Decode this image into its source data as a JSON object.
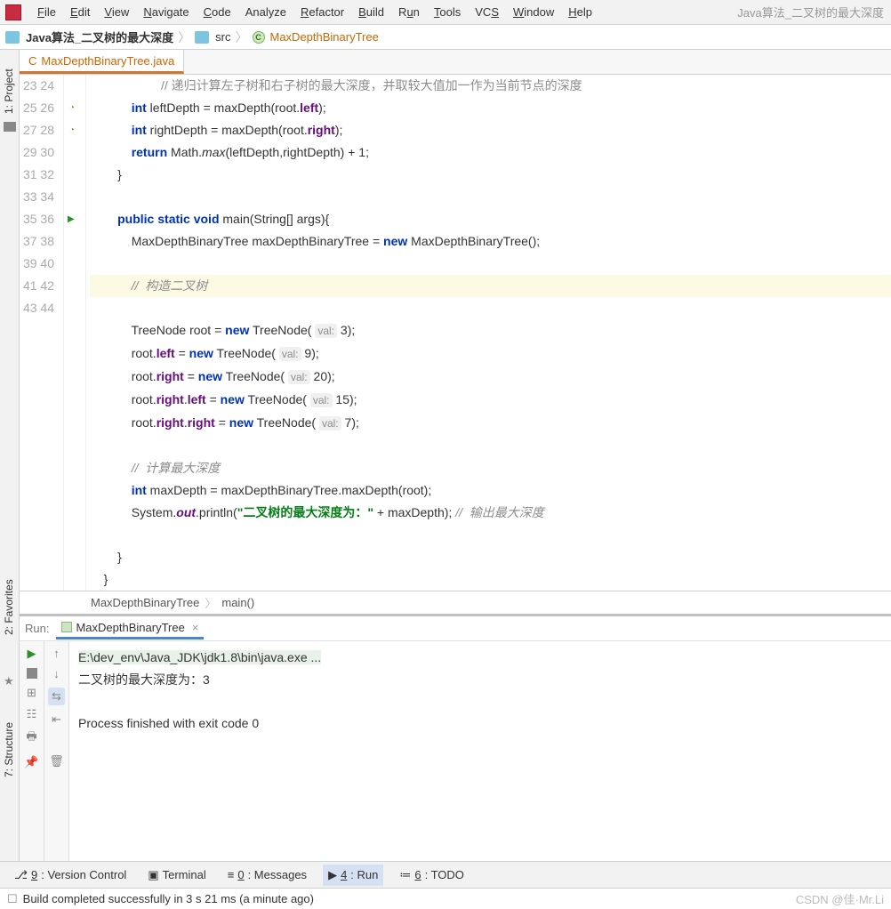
{
  "menu": {
    "file": "File",
    "edit": "Edit",
    "view": "View",
    "navigate": "Navigate",
    "code": "Code",
    "analyze": "Analyze",
    "refactor": "Refactor",
    "build": "Build",
    "run": "Run",
    "tools": "Tools",
    "vcs": "VCS",
    "window": "Window",
    "help": "Help"
  },
  "project_title": "Java算法_二叉树的最大深度",
  "breadcrumb": {
    "proj": "Java算法_二叉树的最大深度",
    "src": "src",
    "class": "MaxDepthBinaryTree"
  },
  "tab": {
    "filename": "MaxDepthBinaryTree.java"
  },
  "code": {
    "lines": [
      "23",
      "24",
      "25",
      "26",
      "27",
      "28",
      "29",
      "30",
      "31",
      "32",
      "33",
      "34",
      "35",
      "36",
      "37",
      "38",
      "39",
      "40",
      "41",
      "42",
      "43",
      "44"
    ],
    "l23": "// 递归计算左子树和右子树的最大深度，并取较大值加一作为当前节点的深度",
    "l24a": "int",
    "l24b": " leftDepth = maxDepth(root.",
    "l24c": "left",
    "l24d": ");",
    "l25a": "int",
    "l25b": " rightDepth = maxDepth(root.",
    "l25c": "right",
    "l25d": ");",
    "l26a": "return",
    "l26b": " Math.",
    "l26c": "max",
    "l26d": "(leftDepth,rightDepth) + 1;",
    "l27": "}",
    "l29a": "public",
    "l29b": " static",
    "l29c": " void",
    "l29d": " main(String[] args){",
    "l30a": "MaxDepthBinaryTree maxDepthBinaryTree = ",
    "l30b": "new",
    "l30c": " MaxDepthBinaryTree();",
    "l32": "//  构造二叉树",
    "l33a": "TreeNode root = ",
    "l33b": "new",
    "l33c": " TreeNode(",
    "l33h": "val:",
    "l33d": " 3);",
    "l34a": "root.",
    "l34b": "left",
    "l34c": " = ",
    "l34d": "new",
    "l34e": " TreeNode(",
    "l34h": "val:",
    "l34f": " 9);",
    "l35a": "root.",
    "l35b": "right",
    "l35c": " = ",
    "l35d": "new",
    "l35e": " TreeNode(",
    "l35h": "val:",
    "l35f": " 20);",
    "l36a": "root.",
    "l36b": "right",
    "l36c": ".",
    "l36d": "left",
    "l36e": " = ",
    "l36f": "new",
    "l36g": " TreeNode(",
    "l36h": "val:",
    "l36i": " 15);",
    "l37a": "root.",
    "l37b": "right",
    "l37c": ".",
    "l37d": "right",
    "l37e": " = ",
    "l37f": "new",
    "l37g": " TreeNode(",
    "l37h": "val:",
    "l37i": " 7);",
    "l39": "//  计算最大深度",
    "l40a": "int",
    "l40b": " maxDepth = maxDepthBinaryTree.maxDepth(root);",
    "l41a": "System.",
    "l41b": "out",
    "l41c": ".println(",
    "l41d": "\"二叉树的最大深度为：\"",
    "l41e": " + maxDepth); ",
    "l41f": "//  输出最大深度",
    "l43": "}",
    "l44": "}"
  },
  "editor_breadcrumb": {
    "class": "MaxDepthBinaryTree",
    "method": "main()"
  },
  "run": {
    "label": "Run:",
    "tab": "MaxDepthBinaryTree",
    "exe": "E:\\dev_env\\Java_JDK\\jdk1.8\\bin\\java.exe ...",
    "out1": "二叉树的最大深度为：3",
    "out2": "Process finished with exit code 0"
  },
  "bottom": {
    "vc": "9: Version Control",
    "term": "Terminal",
    "msg": "0: Messages",
    "run": "4: Run",
    "todo": "6: TODO"
  },
  "status": {
    "msg": "Build completed successfully in 3 s 21 ms (a minute ago)",
    "water": "CSDN @佳·Mr.Li"
  },
  "sidebar": {
    "project": "1: Project",
    "favorites": "2: Favorites",
    "structure": "7: Structure"
  }
}
